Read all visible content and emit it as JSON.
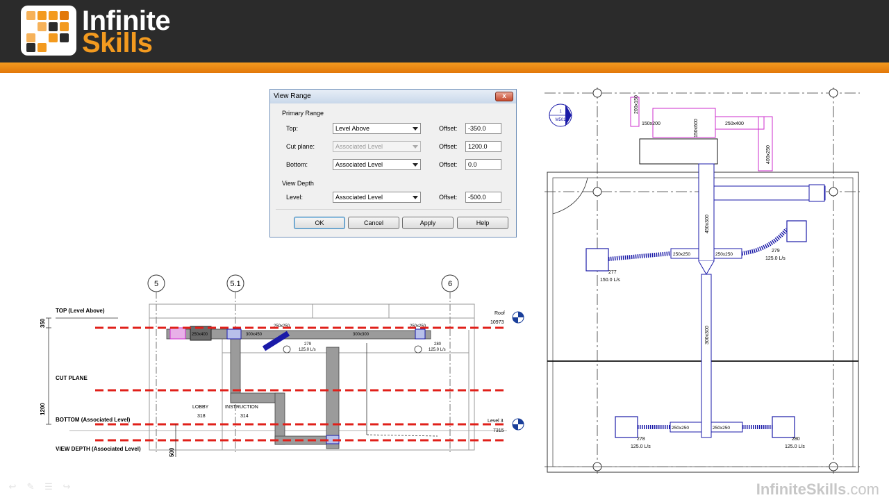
{
  "brand": {
    "word1": "Infinite",
    "word2": "Skills",
    "accent": "#f39a1f",
    "header_bg": "#2b2b2b",
    "watermark_bold": "InfiniteSkills",
    "watermark_rest": ".com"
  },
  "dialog": {
    "title": "View Range",
    "close_label": "x",
    "primary_range_label": "Primary Range",
    "view_depth_label": "View Depth",
    "rows": [
      {
        "label": "Top:",
        "combo": "Level Above",
        "offset_label": "Offset:",
        "offset": "-350.0",
        "disabled": false
      },
      {
        "label": "Cut plane:",
        "combo": "Associated Level",
        "offset_label": "Offset:",
        "offset": "1200.0",
        "disabled": true
      },
      {
        "label": "Bottom:",
        "combo": "Associated Level",
        "offset_label": "Offset:",
        "offset": "0.0",
        "disabled": false
      },
      {
        "label": "Level:",
        "combo": "Associated Level",
        "offset_label": "Offset:",
        "offset": "-500.0",
        "disabled": false
      }
    ],
    "buttons": {
      "ok": "OK",
      "cancel": "Cancel",
      "apply": "Apply",
      "help": "Help"
    }
  },
  "section": {
    "grids": [
      "5",
      "5.1",
      "6"
    ],
    "planes": {
      "top": "TOP (Level Above)",
      "cut": "CUT PLANE",
      "bottom": "BOTTOM (Associated Level)",
      "depth": "VIEW DEPTH (Associated Level)"
    },
    "dims": {
      "d350": "350",
      "d1200": "1200",
      "d500": "500"
    },
    "levels": {
      "roof_name": "Roof",
      "roof_elev": "10973",
      "l3_name": "Level 3",
      "l3_elev": "7315"
    },
    "rooms": {
      "lobby_name": "LOBBY",
      "lobby_no": "318",
      "instr_name": "INSTRUCTION",
      "instr_no": "314"
    },
    "duct_tags": {
      "a": "250x400",
      "b": "300x450",
      "c": "250x250",
      "d": "300x300",
      "e": "250x250"
    },
    "terminals": [
      {
        "id": "279",
        "flow": "125.0 L/s"
      },
      {
        "id": "280",
        "flow": "125.0 L/s"
      }
    ],
    "plane_color": "#e0201a"
  },
  "plan": {
    "callout_top": "1",
    "callout_bottom": "M501",
    "duct_tags": {
      "d200x150": "200x150",
      "d150x200": "150x200",
      "d150x600": "150x600",
      "d250x400": "250x400",
      "d400x250": "400x250",
      "d450x300": "450x300",
      "d300x300": "300x300",
      "d250x250a": "250x250",
      "d250x250b": "250x250",
      "d250x250c": "250x250",
      "d250x250d": "250x250"
    },
    "terminals": [
      {
        "id": "277",
        "flow": "150.0 L/s"
      },
      {
        "id": "279",
        "flow": "125.0 L/s"
      },
      {
        "id": "278",
        "flow": "125.0 L/s"
      },
      {
        "id": "280",
        "flow": "125.0 L/s"
      }
    ],
    "duct_color": "#1a1aa8",
    "accent_color": "#cc2ccc"
  }
}
